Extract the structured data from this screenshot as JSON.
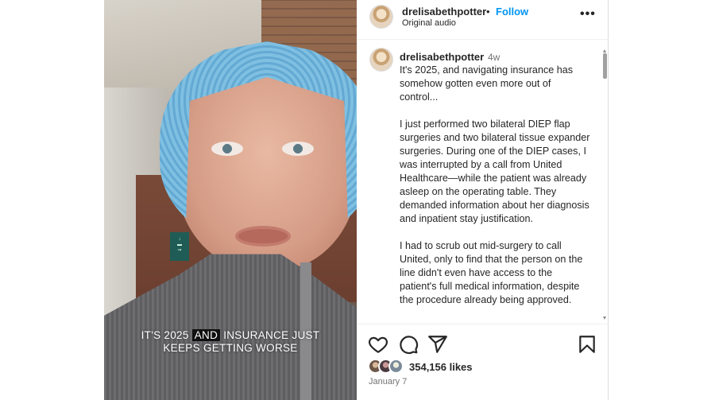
{
  "video": {
    "caption_before": "IT'S 2025",
    "caption_highlight": "AND",
    "caption_after": "INSURANCE JUST",
    "caption_line2": "KEEPS GETTING WORSE"
  },
  "header": {
    "username": "drelisabethpotter",
    "separator": "•",
    "follow_label": "Follow",
    "audio_label": "Original audio",
    "more_label": "•••"
  },
  "comment": {
    "username": "drelisabethpotter",
    "time": "4w",
    "body": "It's 2025, and navigating insurance has somehow gotten even more out of control...\n\nI just performed two bilateral DIEP flap surgeries and two bilateral tissue expander surgeries. During one of the DIEP cases, I was interrupted by a call from United Healthcare—while the patient was already asleep on the operating table. They demanded information about her diagnosis and inpatient stay justification.\n\nI had to scrub out mid-surgery to call United, only to find that the person on the line didn't even have access to the patient's full medical information, despite the procedure already being approved."
  },
  "actions": {
    "likes_label": "354,156 likes",
    "date": "January 7"
  },
  "icons": [
    "heart-icon",
    "comment-icon",
    "share-icon",
    "bookmark-icon",
    "more-icon"
  ]
}
